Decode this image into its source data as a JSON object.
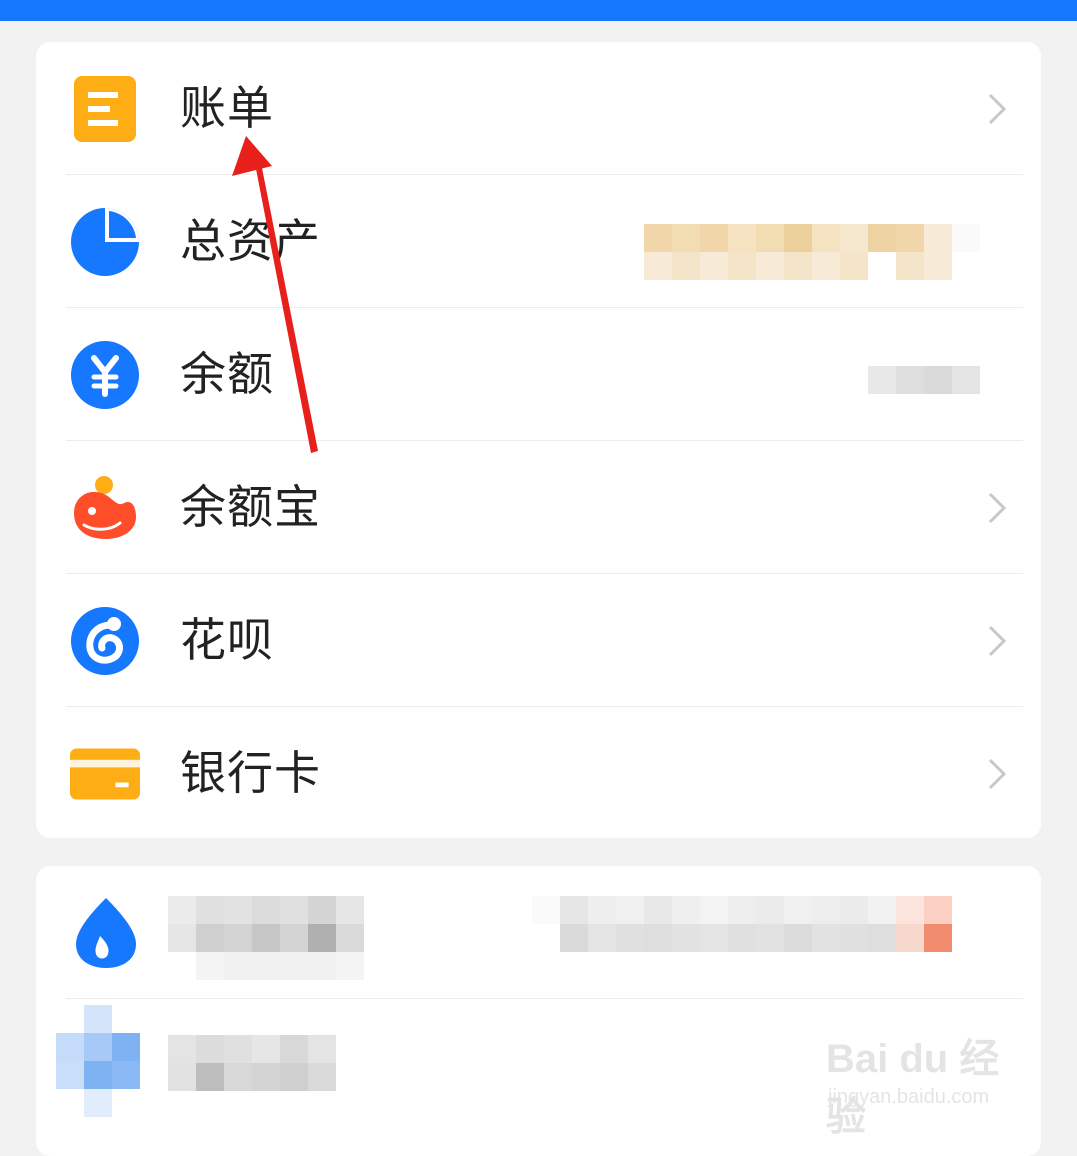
{
  "menu": {
    "items": [
      {
        "label": "账单",
        "icon": "bill-icon",
        "has_chevron": true
      },
      {
        "label": "总资产",
        "icon": "pie-chart-icon",
        "has_chevron": false
      },
      {
        "label": "余额",
        "icon": "yen-icon",
        "has_chevron": false
      },
      {
        "label": "余额宝",
        "icon": "dolphin-icon",
        "has_chevron": true
      },
      {
        "label": "花呗",
        "icon": "huabei-icon",
        "has_chevron": true
      },
      {
        "label": "银行卡",
        "icon": "bank-card-icon",
        "has_chevron": true
      }
    ]
  },
  "watermark": {
    "main": "Bai du 经验",
    "sub": "jingyan.baidu.com"
  },
  "colors": {
    "topbar": "#1677ff",
    "blue_icon": "#1677ff",
    "orange_icon": "#ffad14",
    "red_icon": "#ff4d2a",
    "arrow": "#e8201c"
  }
}
